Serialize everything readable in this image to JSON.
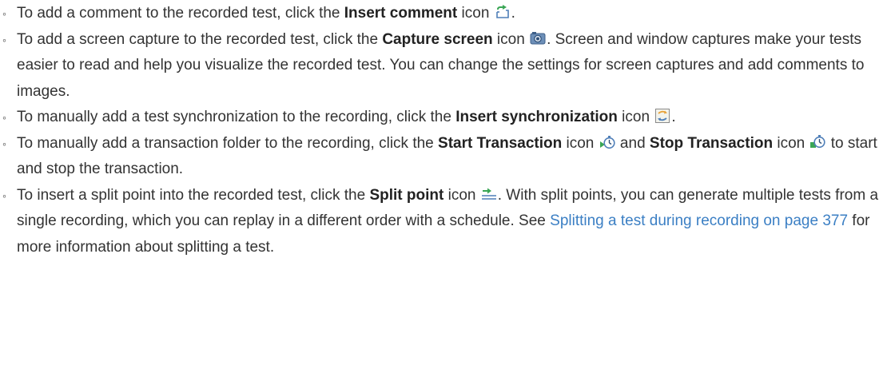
{
  "items": [
    {
      "bullet": "◦",
      "t1": "To add a comment to the recorded test, click the ",
      "b1": "Insert comment",
      "t2": " icon ",
      "icon1": "insert-comment-icon",
      "t3": "."
    },
    {
      "bullet": "◦",
      "t1": "To add a screen capture to the recorded test, click the ",
      "b1": "Capture screen",
      "t2": " icon ",
      "icon1": "capture-screen-icon",
      "t3": ". Screen and window captures make your tests easier to read and help you visualize the recorded test. You can change the settings for screen captures and add comments to images."
    },
    {
      "bullet": "◦",
      "t1": "To manually add a test synchronization to the recording, click the ",
      "b1": "Insert synchronization",
      "t2": " icon ",
      "icon1": "insert-synchronization-icon",
      "t3": "."
    },
    {
      "bullet": "◦",
      "t1": "To manually add a transaction folder to the recording, click the ",
      "b1": "Start Transaction",
      "t2": " icon ",
      "icon1": "start-transaction-icon",
      "t3": " and ",
      "b2": "Stop Transaction",
      "t4": " icon ",
      "icon2": "stop-transaction-icon",
      "t5": " to start and stop the transaction."
    },
    {
      "bullet": "◦",
      "t1": "To insert a split point into the recorded test, click the ",
      "b1": "Split point",
      "t2": " icon ",
      "icon1": "split-point-icon",
      "t3": ". With split points, you can generate multiple tests from a single recording, which you can replay in a different order with a schedule. See ",
      "link": "Splitting a test during recording on page 377",
      "t4": " for more information about splitting a test."
    }
  ],
  "colors": {
    "text": "#333333",
    "bold": "#222222",
    "link": "#3b7fc4",
    "icon_green": "#3aa655",
    "icon_blue": "#4f7fb8",
    "icon_orange": "#e8a33a"
  }
}
